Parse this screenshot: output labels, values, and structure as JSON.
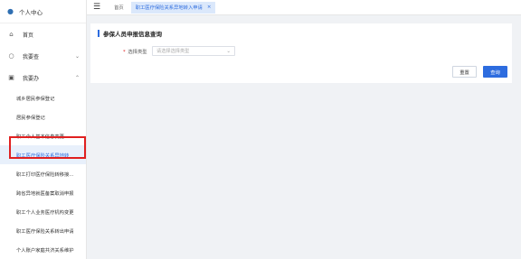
{
  "sidebar": {
    "header": "个人中心",
    "items": [
      {
        "label": "首页",
        "icon": "home-icon"
      },
      {
        "label": "我要查",
        "icon": "search-icon"
      },
      {
        "label": "我要办",
        "icon": "folder-icon"
      }
    ],
    "subitems": [
      "城乡居民参保登记",
      "居民参保登记",
      "职工个人基本信息变更",
      "职工医疗保险关系异地转",
      "职工打印医疗保险转移接...",
      "跨省异地就医备案取消申报",
      "职工个人业务医疗机构变更",
      "职工医疗保险关系转出申请",
      "个人账户家庭共济关系维护"
    ]
  },
  "topbar": {
    "tabs": [
      {
        "label": "首页"
      },
      {
        "label": "职工医疗保险关系异地转入申请"
      }
    ]
  },
  "card": {
    "title": "参保人员申报信息查询",
    "field_label": "选择类型",
    "field_placeholder": "请选择选择类型",
    "reset_label": "重置",
    "query_label": "查询"
  },
  "colors": {
    "accent": "#2d6cdf",
    "highlight": "#e02020"
  }
}
